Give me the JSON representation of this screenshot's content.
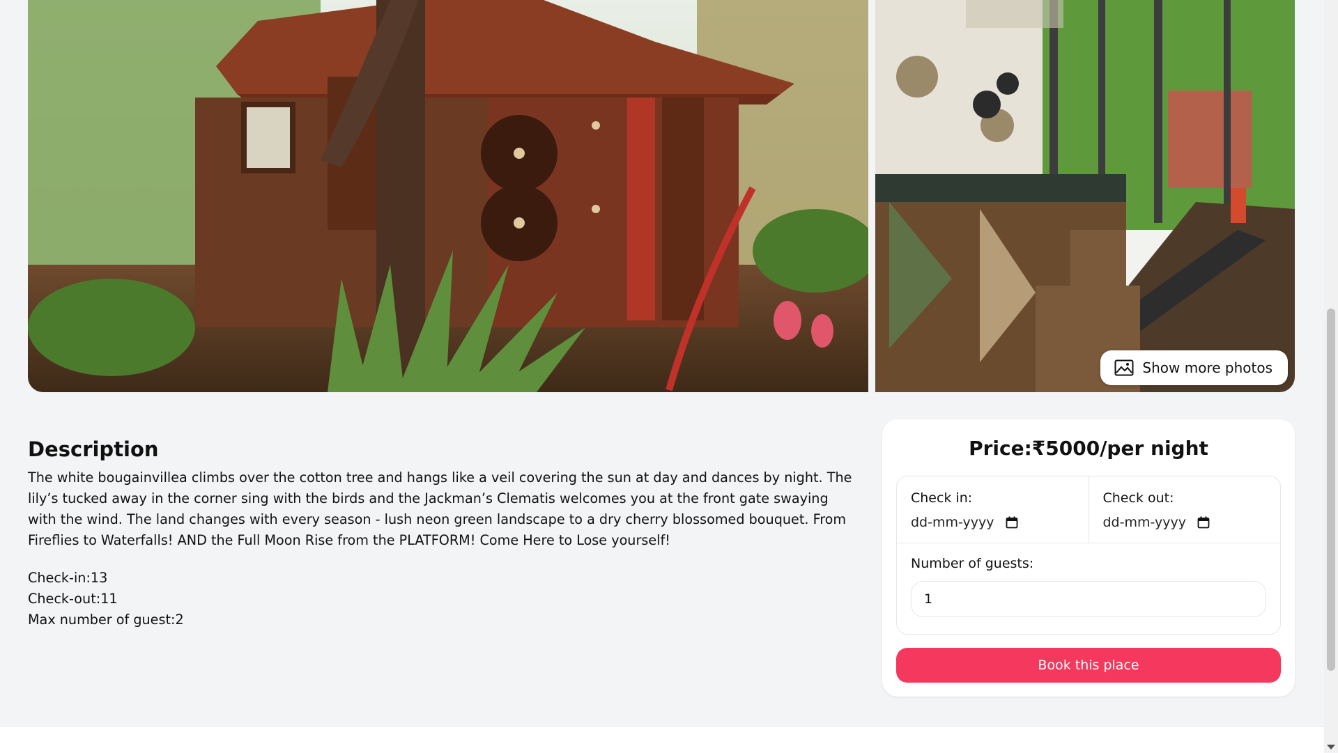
{
  "gallery": {
    "show_more_label": "Show more photos",
    "show_more_icon": "photo-icon"
  },
  "description": {
    "title": "Description",
    "text": "The white bougainvillea climbs over the cotton tree and hangs like a veil covering the sun at day and dances by night. The lily’s tucked away in the corner sing with the birds and the Jackman’s Clematis welcomes you at the front gate swaying with the wind. The land changes with every season - lush neon green landscape to a dry cherry blossomed bouquet. From Fireflies to Waterfalls! AND the Full Moon Rise from the PLATFORM! Come Here to Lose yourself!",
    "check_in": "Check-in:13",
    "check_out": "Check-out:11",
    "max_guests": "Max number of guest:2"
  },
  "booking": {
    "price": "Price:₹5000/per night",
    "check_in_label": "Check in:",
    "check_in_value": "dd-mm-yyyy",
    "check_out_label": "Check out:",
    "check_out_value": "dd-mm-yyyy",
    "guests_label": "Number of guests:",
    "guests_value": "1",
    "book_label": "Book this place",
    "accent_color": "#f5385d"
  }
}
